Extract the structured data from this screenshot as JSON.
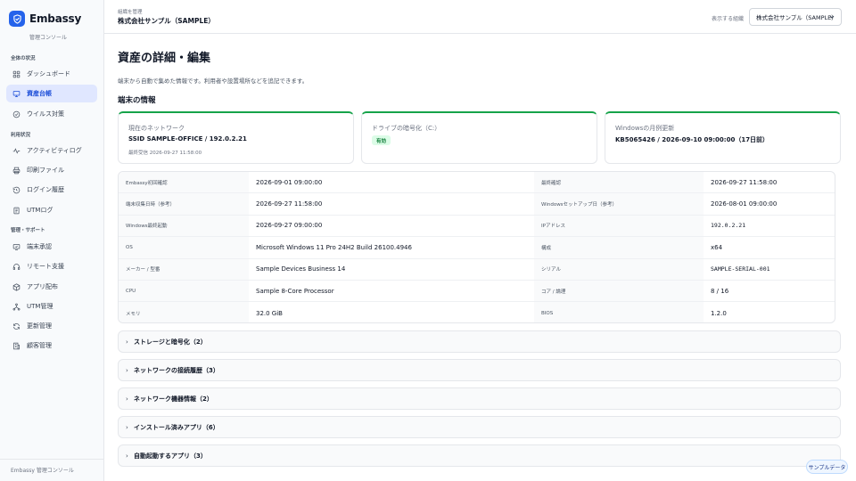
{
  "brand": {
    "name": "Embassy",
    "subtitle": "管理コンソール"
  },
  "sidebar": {
    "sections": [
      {
        "label": "全体の状況",
        "items": [
          {
            "label": "ダッシュボード",
            "icon": "grid-icon",
            "active": false
          },
          {
            "label": "資産台帳",
            "icon": "monitor-icon",
            "active": true
          },
          {
            "label": "ウイルス対策",
            "icon": "shield-check-icon",
            "active": false
          }
        ]
      },
      {
        "label": "利用状況",
        "items": [
          {
            "label": "アクティビティログ",
            "icon": "activity-icon",
            "active": false
          },
          {
            "label": "印刷ファイル",
            "icon": "printer-icon",
            "active": false
          },
          {
            "label": "ログイン履歴",
            "icon": "history-icon",
            "active": false
          },
          {
            "label": "UTMログ",
            "icon": "document-icon",
            "active": false
          }
        ]
      },
      {
        "label": "管理・サポート",
        "items": [
          {
            "label": "端末承認",
            "icon": "approve-icon",
            "active": false
          },
          {
            "label": "リモート支援",
            "icon": "headset-icon",
            "active": false
          },
          {
            "label": "アプリ配布",
            "icon": "package-icon",
            "active": false
          },
          {
            "label": "UTM管理",
            "icon": "network-icon",
            "active": false
          },
          {
            "label": "更新管理",
            "icon": "refresh-icon",
            "active": false
          },
          {
            "label": "顧客管理",
            "icon": "building-icon",
            "active": false
          }
        ]
      }
    ],
    "footer": "Embassy 管理コンソール"
  },
  "header": {
    "org_caption": "組織を管理",
    "org_name": "株式会社サンプル（SAMPLE）",
    "select_label": "表示する組織",
    "select_value": "株式会社サンプル（SAMPLE）"
  },
  "main": {
    "title": "資産の詳細・編集",
    "description": "端末から自動で集めた情報です。利用者や設置場所などを追記できます。",
    "section_title": "端末の情報",
    "cards": [
      {
        "label": "現在のネットワーク",
        "value": "SSID SAMPLE-OFFICE / 192.0.2.21",
        "meta": "最終受信 2026-09-27 11:58:00"
      },
      {
        "label": "ドライブの暗号化（C:）",
        "badge": "有効"
      },
      {
        "label": "Windowsの月例更新",
        "value": "KB5065426 / 2026-09-10 09:00:00（17日前）"
      }
    ],
    "info_rows": [
      [
        "Embassy初回確認",
        "2026-09-01 09:00:00",
        "最終確認",
        "2026-09-27 11:58:00"
      ],
      [
        "端末収集日時（参考）",
        "2026-09-27 11:58:00",
        "Windowsセットアップ日（参考）",
        "2026-08-01 09:00:00"
      ],
      [
        "Windows最終起動",
        "2026-09-27 09:00:00",
        "IPアドレス",
        "192.0.2.21"
      ],
      [
        "OS",
        "Microsoft Windows 11 Pro 24H2 Build 26100.4946",
        "構成",
        "x64"
      ],
      [
        "メーカー / 型番",
        "Sample Devices Business 14",
        "シリアル",
        "SAMPLE-SERIAL-001"
      ],
      [
        "CPU",
        "Sample 8-Core Processor",
        "コア / 論理",
        "8 / 16"
      ],
      [
        "メモリ",
        "32.0 GiB",
        "BIOS",
        "1.2.0"
      ]
    ],
    "accordions": [
      {
        "label": "ストレージと暗号化（2）"
      },
      {
        "label": "ネットワークの接続履歴（3）"
      },
      {
        "label": "ネットワーク機器情報（2）"
      },
      {
        "label": "インストール済みアプリ（6）"
      },
      {
        "label": "自動起動するアプリ（3）"
      }
    ]
  },
  "sample_chip": "サンプルデータ",
  "colors": {
    "accent": "#2563eb",
    "active_bg": "#e0e7ff",
    "success": "#16a34a"
  }
}
